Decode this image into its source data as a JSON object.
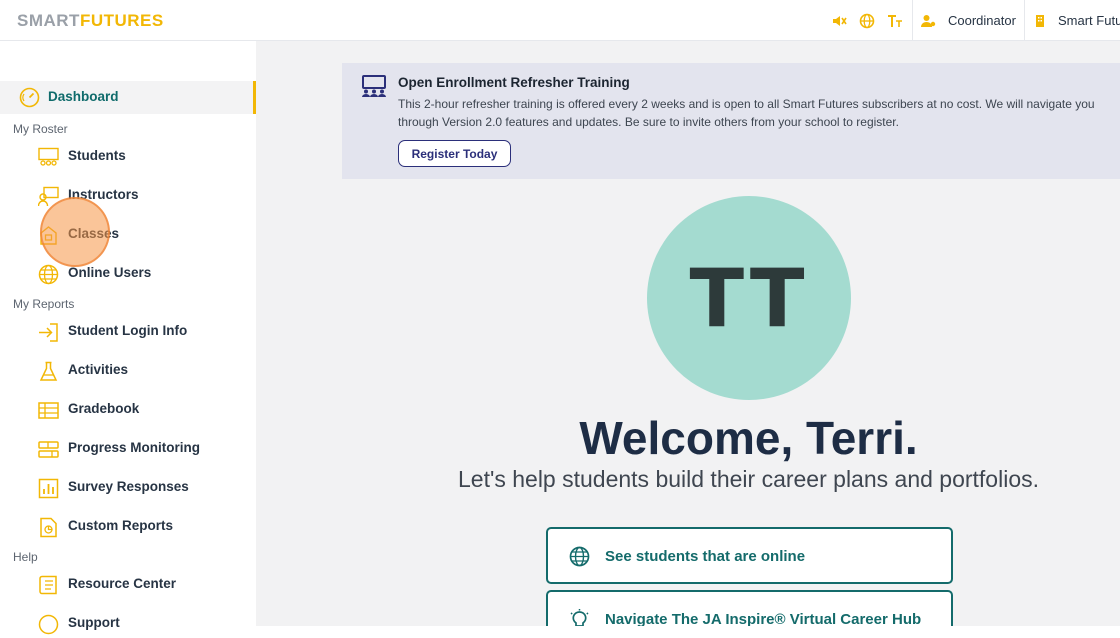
{
  "app": {
    "logo_part1": "SMART",
    "logo_part2": "FUTURES"
  },
  "topbar": {
    "icons": [
      "sound-off-icon",
      "globe-icon",
      "text-size-icon"
    ],
    "role_label": "Coordinator",
    "school_label": "Smart Futu"
  },
  "sidebar": {
    "dashboard": "Dashboard",
    "sections": {
      "roster": "My Roster",
      "reports": "My Reports",
      "help": "Help"
    },
    "roster_items": [
      "Students",
      "Instructors",
      "Classes",
      "Online Users"
    ],
    "report_items": [
      "Student Login Info",
      "Activities",
      "Gradebook",
      "Progress Monitoring",
      "Survey Responses",
      "Custom Reports"
    ],
    "help_items": [
      "Resource Center",
      "Support"
    ]
  },
  "banner": {
    "title": "Open Enrollment Refresher Training",
    "body": "This 2-hour refresher training is offered every 2 weeks and is open to all Smart Futures subscribers at no cost. We will navigate you through Version 2.0 features and updates. Be sure to invite others from your school to register.",
    "button": "Register Today"
  },
  "welcome": {
    "initials": "TT",
    "heading": "Welcome, Terri.",
    "subheading": "Let's help students build their career plans and portfolios."
  },
  "actions": {
    "online": "See students that are online",
    "hub": "Navigate The JA Inspire® Virtual Career Hub"
  },
  "colors": {
    "accent": "#f2b705",
    "teal": "#146b6b",
    "navy": "#1e2d45",
    "avatar_bg": "#a4dbd0"
  }
}
